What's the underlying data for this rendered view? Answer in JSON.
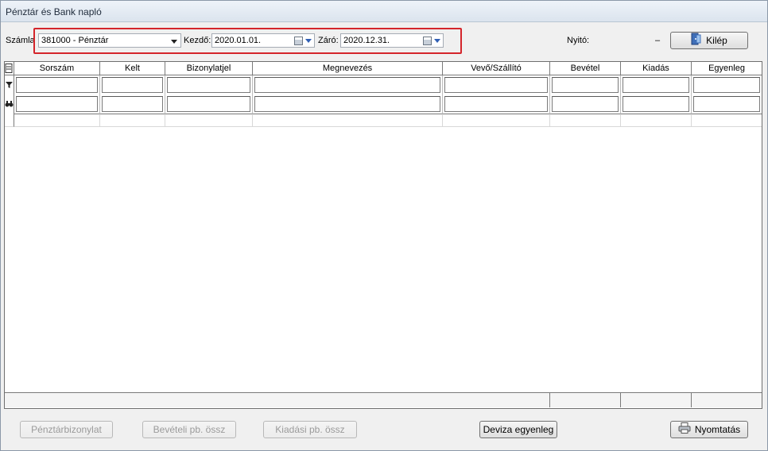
{
  "window": {
    "title": "Pénztár és Bank napló"
  },
  "toolbar": {
    "account_label": "Számla",
    "account_value": "381000 - Pénztár",
    "start_label": "Kezdő:",
    "start_value": "2020.01.01.",
    "end_label": "Záró:",
    "end_value": "2020.12.31.",
    "opening_label": "Nyitó:",
    "opening_value": "–",
    "exit_label": "Kilép"
  },
  "grid": {
    "columns": [
      "Sorszám",
      "Kelt",
      "Bizonylatjel",
      "Megnevezés",
      "Vevő/Szállító",
      "Bevétel",
      "Kiadás",
      "Egyenleg"
    ]
  },
  "buttons": {
    "cash_voucher": "Pénztárbizonylat",
    "income_summary": "Bevételi pb. össz",
    "expense_summary": "Kiadási pb. össz",
    "currency_balance": "Deviza egyenleg",
    "print": "Nyomtatás"
  },
  "colors": {
    "highlight": "#d4252b"
  }
}
